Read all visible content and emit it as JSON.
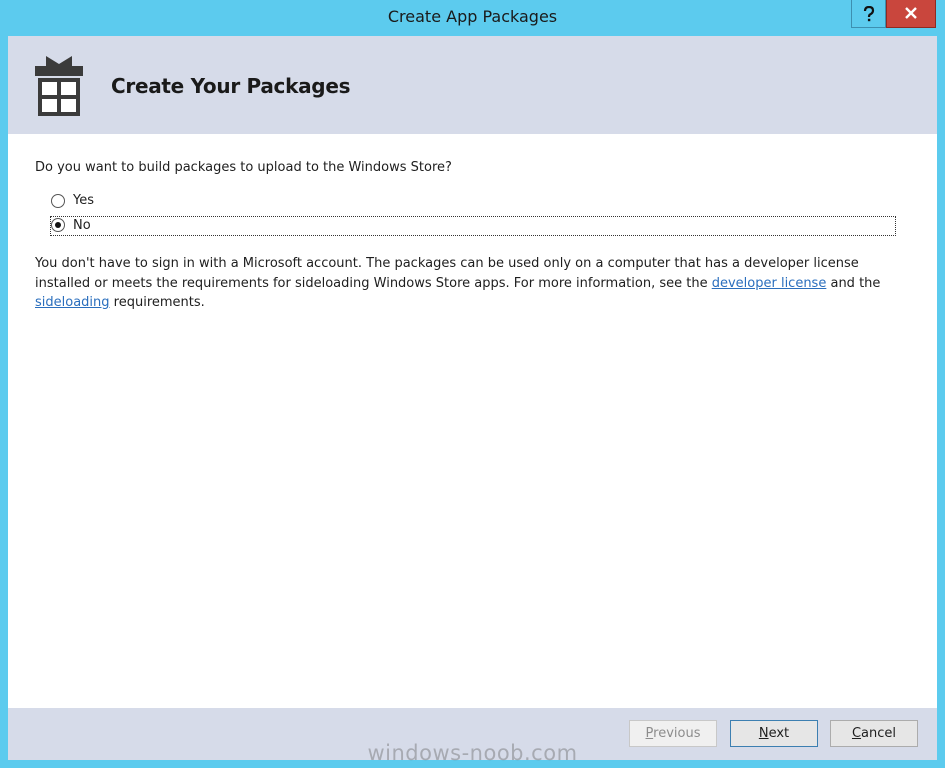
{
  "window": {
    "title": "Create App Packages",
    "help_glyph": "?",
    "close_glyph": "×",
    "accent_color": "#5ccbee",
    "close_color": "#c9463d"
  },
  "header": {
    "title": "Create Your Packages",
    "icon": "package-icon"
  },
  "main": {
    "question": "Do you want to build packages to upload to the Windows Store?",
    "options": [
      {
        "label": "Yes",
        "selected": false
      },
      {
        "label": "No",
        "selected": true
      }
    ],
    "description": {
      "part1": "You don't have to sign in with a Microsoft account. The packages can be used only on a computer that has a developer license installed or meets the requirements for sideloading Windows Store apps. For more information, see the ",
      "link1": "developer license",
      "part2": " and the ",
      "link2": "sideloading",
      "part3": " requirements."
    }
  },
  "footer": {
    "previous": {
      "prefix": "",
      "accel": "P",
      "rest": "revious",
      "enabled": false
    },
    "next": {
      "prefix": "",
      "accel": "N",
      "rest": "ext",
      "enabled": true
    },
    "cancel": {
      "prefix": "",
      "accel": "C",
      "rest": "ancel",
      "enabled": true
    }
  },
  "watermark": "windows-noob.com"
}
